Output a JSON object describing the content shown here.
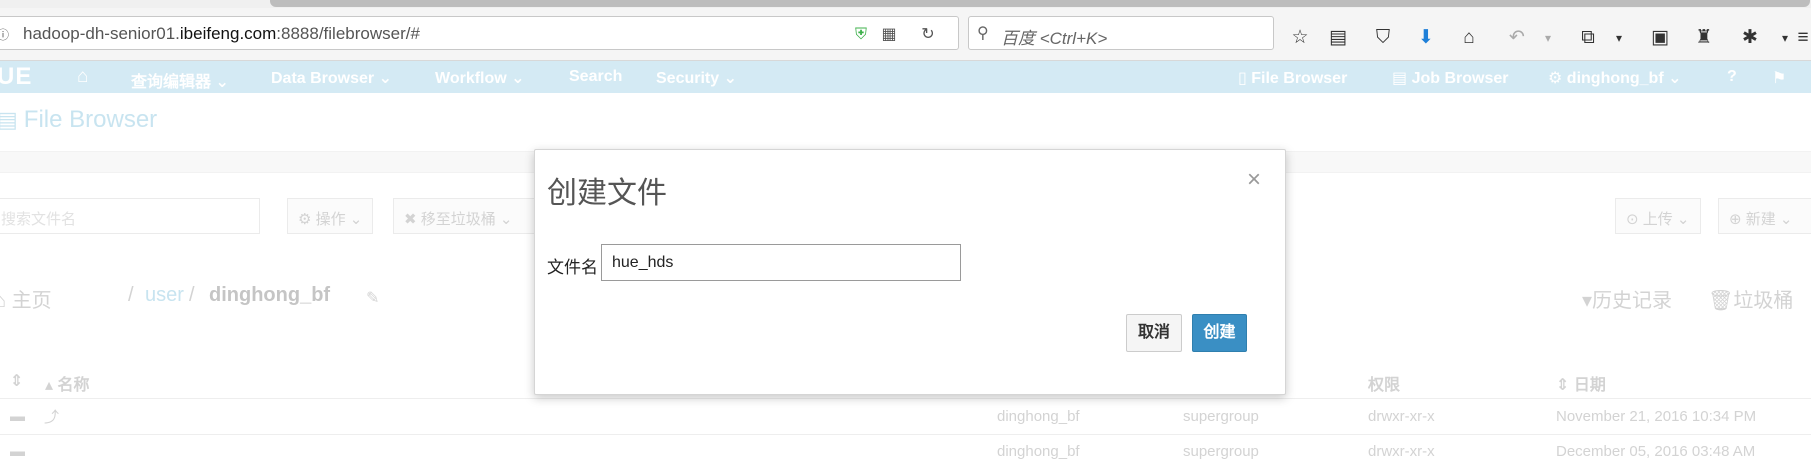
{
  "browser": {
    "info_icon": "info-icon",
    "url_prefix": "hadoop-dh-senior01.",
    "url_domain": "ibeifeng.com",
    "url_suffix": ":8888/filebrowser/#",
    "search_placeholder": "百度 <Ctrl+K>"
  },
  "navbar": {
    "logo": "UE",
    "items": [
      "查询编辑器",
      "Data Browser",
      "Workflow",
      "Search",
      "Security"
    ],
    "right_items": [
      "File Browser",
      "Job Browser",
      "dinghong_bf"
    ]
  },
  "page": {
    "title": "File Browser",
    "filter_placeholder": "搜索文件名",
    "actions_button": "操作",
    "trash_button": "移至垃圾桶",
    "upload_button": "上传",
    "new_button": "新建",
    "breadcrumb_home": "主页",
    "breadcrumb_sep1": "/",
    "breadcrumb_user": "user",
    "breadcrumb_sep2": "/",
    "breadcrumb_current": "dinghong_bf",
    "history_link": "历史记录",
    "trash_link": "垃圾桶"
  },
  "table": {
    "headers": {
      "name": "名称",
      "permissions": "权限",
      "date": "日期"
    },
    "rows": [
      {
        "name": "",
        "owner": "dinghong_bf",
        "group": "supergroup",
        "perm": "drwxr-xr-x",
        "date": "November 21, 2016 10:34 PM"
      },
      {
        "name": "",
        "owner": "dinghong_bf",
        "group": "supergroup",
        "perm": "drwxr-xr-x",
        "date": "December 05, 2016 03:48 AM"
      }
    ]
  },
  "modal": {
    "title": "创建文件",
    "close": "×",
    "field_label": "文件名",
    "field_value": "hue_hds",
    "cancel": "取消",
    "create": "创建"
  }
}
